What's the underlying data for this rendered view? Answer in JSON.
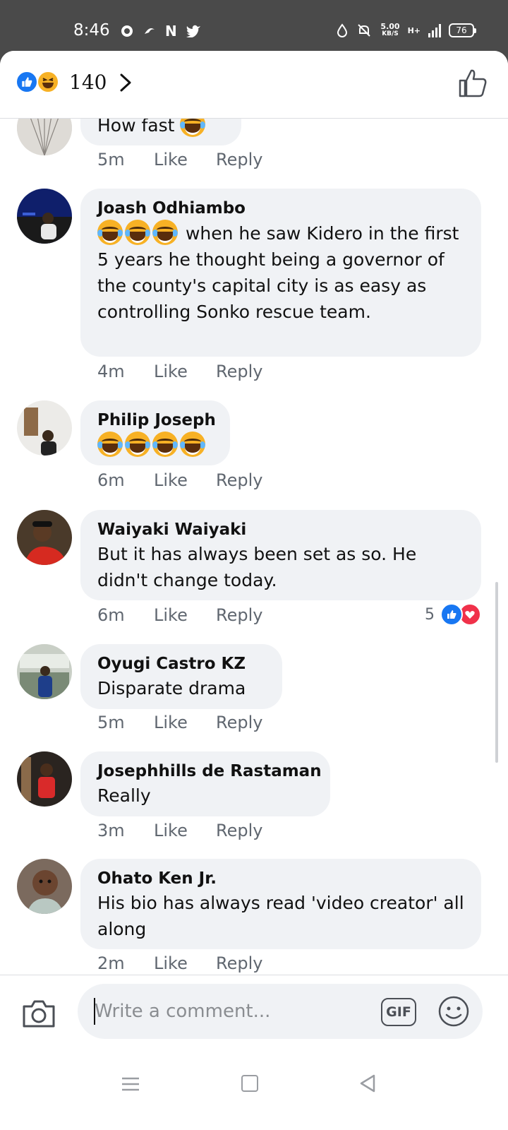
{
  "status_bar": {
    "time": "8:46",
    "left_icons": [
      "settings-icon",
      "swirl-app-icon",
      "n-app-icon",
      "twitter-icon"
    ],
    "speed_value": "5.00",
    "speed_unit": "KB/S",
    "network": "H+",
    "battery": "76"
  },
  "header": {
    "reaction_count": "140",
    "reaction_types": [
      "like",
      "haha"
    ]
  },
  "comments": [
    {
      "name": "",
      "text": "How fast",
      "time": "5m",
      "like_label": "Like",
      "reply_label": "Reply"
    },
    {
      "name": "Joash Odhiambo",
      "text": "when he saw Kidero in the first 5 years he thought being a governor of the county's capital city is as easy as controlling Sonko rescue team.",
      "time": "4m",
      "like_label": "Like",
      "reply_label": "Reply"
    },
    {
      "name": "Philip Joseph",
      "text": "",
      "time": "6m",
      "like_label": "Like",
      "reply_label": "Reply"
    },
    {
      "name": "Waiyaki Waiyaki",
      "text": "But it has always been set as so. He didn't change today.",
      "time": "6m",
      "like_label": "Like",
      "reply_label": "Reply",
      "reaction_count": "5"
    },
    {
      "name": "Oyugi Castro KZ",
      "text": "Disparate drama",
      "time": "5m",
      "like_label": "Like",
      "reply_label": "Reply"
    },
    {
      "name": "Josephhills de Rastaman",
      "text": "Really",
      "time": "3m",
      "like_label": "Like",
      "reply_label": "Reply"
    },
    {
      "name": "Ohato Ken Jr.",
      "text": "His bio has always read 'video creator' all along",
      "time": "2m",
      "like_label": "Like",
      "reply_label": "Reply"
    }
  ],
  "composer": {
    "placeholder": "Write a comment...",
    "gif_label": "GIF"
  },
  "colors": {
    "accent": "#1877f2",
    "bubble": "#f0f2f5",
    "love": "#f0314a",
    "haha": "#f7b125"
  }
}
